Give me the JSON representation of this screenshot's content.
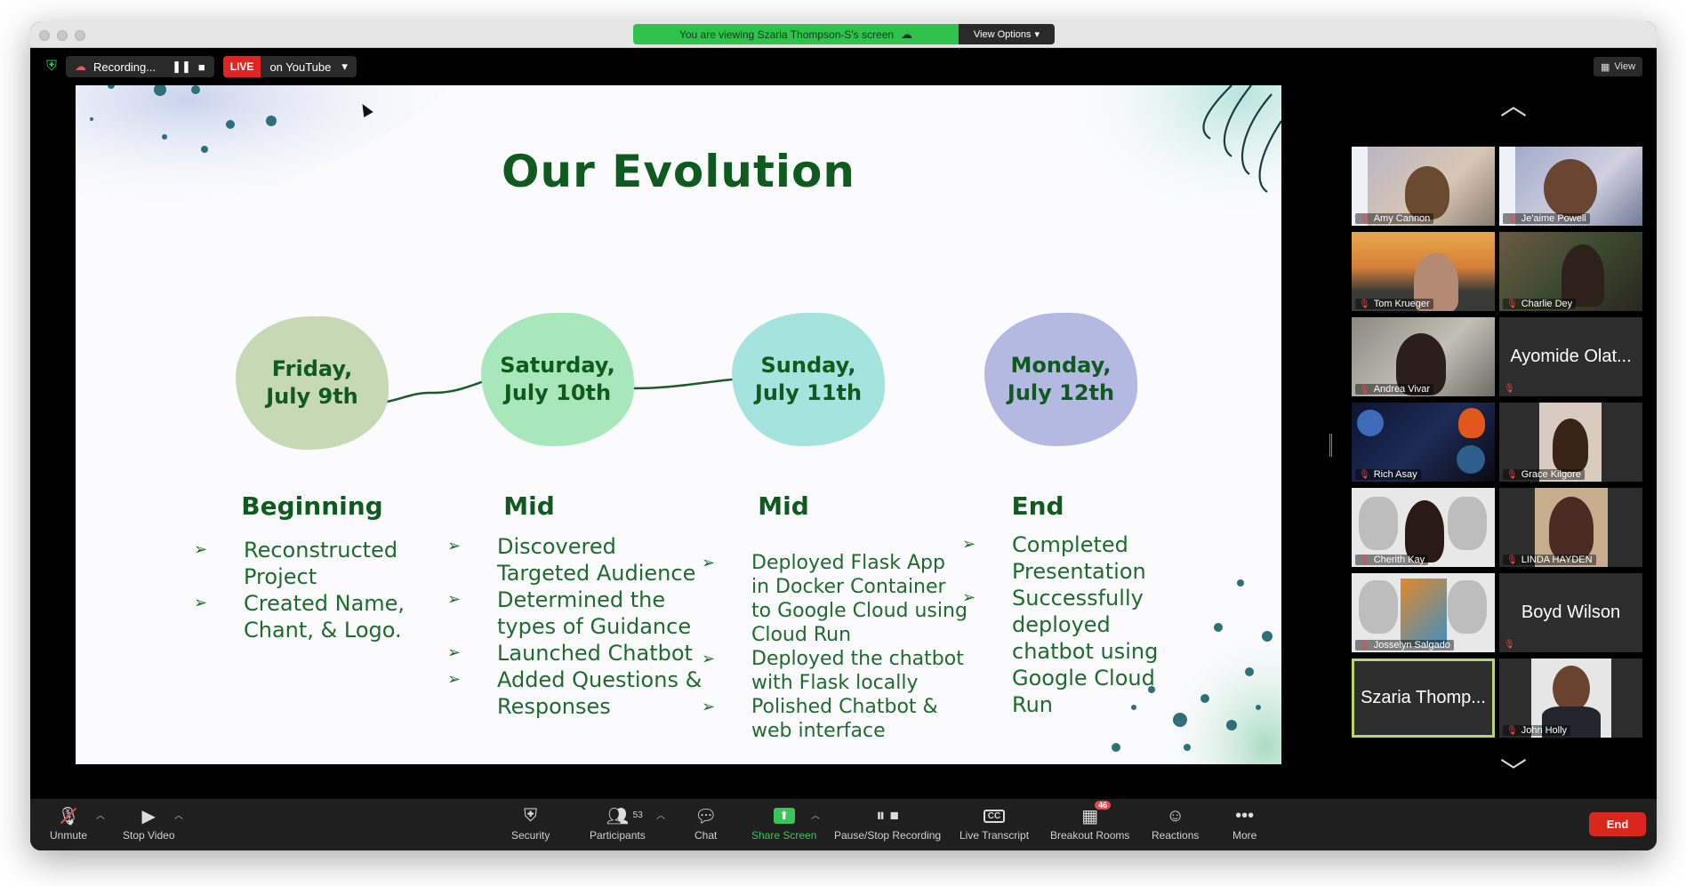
{
  "window": {
    "share_banner": "You are viewing Szaria Thompson-S's screen",
    "view_options": "View Options",
    "view_label": "View"
  },
  "recording": {
    "label": "Recording...",
    "live": "LIVE",
    "platform": "on YouTube"
  },
  "slide": {
    "title": "Our Evolution",
    "timeline": [
      {
        "line1": "Friday,",
        "line2": "July 9th",
        "color": "#c6d8b4"
      },
      {
        "line1": "Saturday,",
        "line2": "July 10th",
        "color": "#a7e7ba"
      },
      {
        "line1": "Sunday,",
        "line2": "July 11th",
        "color": "#a5e3df"
      },
      {
        "line1": "Monday,",
        "line2": "July 12th",
        "color": "#b4b9e2"
      }
    ],
    "columns": [
      {
        "heading": "Beginning",
        "bullets": [
          "Reconstructed Project",
          "Created Name, Chant, & Logo."
        ]
      },
      {
        "heading": "Mid",
        "bullets": [
          "Discovered Targeted Audience",
          "Determined the types of Guidance",
          "Launched Chatbot",
          "Added Questions & Responses"
        ]
      },
      {
        "heading": "Mid",
        "bullets": [
          "Deployed Flask App in Docker Container to Google Cloud using Cloud Run",
          "Deployed the chatbot with Flask locally",
          "Polished Chatbot & web interface"
        ]
      },
      {
        "heading": "End",
        "bullets": [
          "Completed Presentation",
          "Successfully deployed chatbot using Google Cloud Run"
        ]
      }
    ]
  },
  "participants": [
    {
      "name": "Amy Cannon",
      "type": "video"
    },
    {
      "name": "Je'aime Powell",
      "type": "video"
    },
    {
      "name": "Tom Krueger",
      "type": "video"
    },
    {
      "name": "Charlie Dey",
      "type": "video"
    },
    {
      "name": "Andrea Vivar",
      "type": "video"
    },
    {
      "name": "Ayomide Olat...",
      "type": "name"
    },
    {
      "name": "Rich Asay",
      "type": "video"
    },
    {
      "name": "Grace Kilgore",
      "type": "video"
    },
    {
      "name": "Cherith Kay",
      "type": "video"
    },
    {
      "name": "LINDA HAYDEN",
      "type": "video"
    },
    {
      "name": "Josselyn Salgado",
      "type": "video"
    },
    {
      "name": "Boyd Wilson",
      "type": "name"
    },
    {
      "name": "Szaria Thomp...",
      "type": "name"
    },
    {
      "name": "John Holly",
      "type": "video"
    }
  ],
  "toolbar": {
    "unmute": "Unmute",
    "stop_video": "Stop Video",
    "security": "Security",
    "participants": "Participants",
    "participants_count": "53",
    "chat": "Chat",
    "share_screen": "Share Screen",
    "pause_stop": "Pause/Stop Recording",
    "live_transcript": "Live Transcript",
    "breakout_rooms": "Breakout Rooms",
    "breakout_badge": "46",
    "reactions": "Reactions",
    "more": "More",
    "end": "End"
  },
  "colors": {
    "accent_green": "#2fc24d",
    "live_red": "#e02424",
    "slide_green": "#0f5a1f",
    "active_border": "#b8d66a"
  }
}
